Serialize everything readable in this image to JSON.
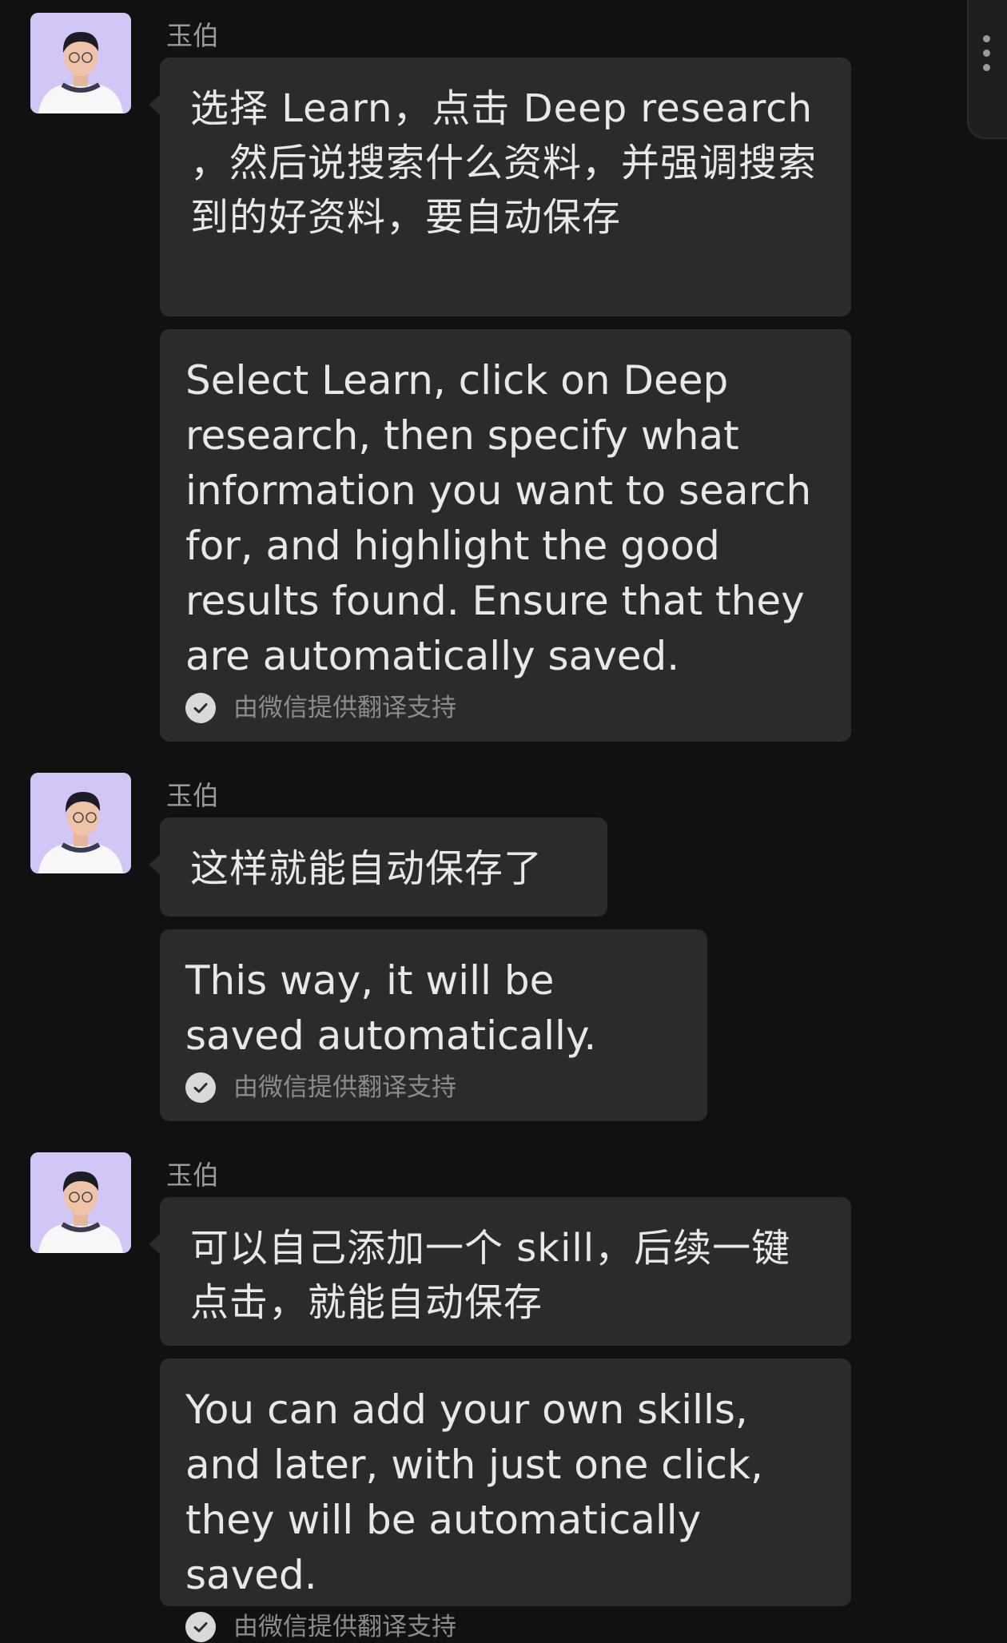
{
  "messages": [
    {
      "sender": "玉伯",
      "original": "选择 Learn，点击 Deep research ，然后说搜索什么资料，并强调搜索到的好资料，要自动保存",
      "translation": "Select Learn, click on Deep research, then specify what information you want to search for, and highlight the good results found. Ensure that they are automatically saved.",
      "translation_note": "由微信提供翻译支持"
    },
    {
      "sender": "玉伯",
      "original": "这样就能自动保存了",
      "translation": "This way, it will be saved automatically.",
      "translation_note": "由微信提供翻译支持"
    },
    {
      "sender": "玉伯",
      "original": "可以自己添加一个 skill，后续一键点击，就能自动保存",
      "translation": "You can add your own skills, and later, with just one click, they will be automatically saved.",
      "translation_note": "由微信提供翻译支持"
    }
  ],
  "colors": {
    "background": "#111111",
    "bubble": "#2b2b2b",
    "text": "#e8e8e8",
    "sender": "#9a9a9a",
    "note": "#8c8c8c"
  },
  "icons": {
    "translation_check": "check-circle-icon",
    "more": "more-vertical-icon"
  }
}
